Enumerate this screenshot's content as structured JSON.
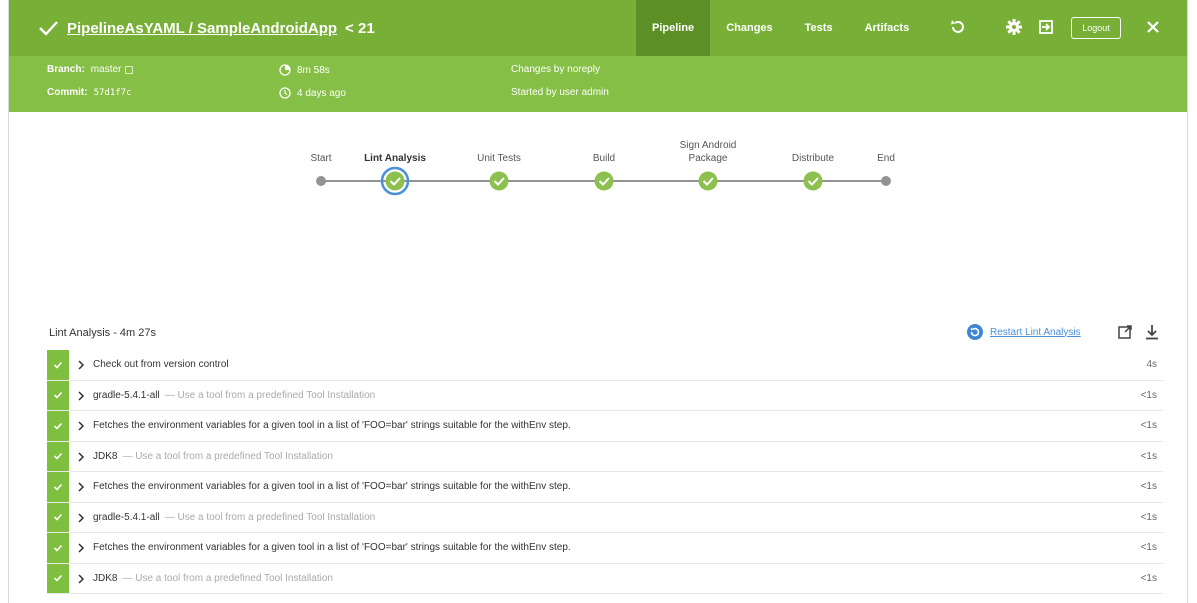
{
  "header": {
    "title": "PipelineAsYAML / SampleAndroidApp",
    "run_number": "< 21",
    "tabs": [
      {
        "label": "Pipeline",
        "active": true
      },
      {
        "label": "Changes",
        "active": false
      },
      {
        "label": "Tests",
        "active": false
      },
      {
        "label": "Artifacts",
        "active": false
      }
    ],
    "logout_label": "Logout",
    "icons": [
      "check-icon",
      "rerun-icon",
      "gear-icon",
      "exit-icon",
      "close-icon"
    ],
    "bg_color": "#78b037"
  },
  "meta": {
    "branch_label": "Branch:",
    "branch_value": "master",
    "commit_label": "Commit:",
    "commit_value": "57d1f7c",
    "duration": "8m 58s",
    "ago": "4 days ago",
    "changes": "Changes by noreply",
    "started": "Started by user admin"
  },
  "pipeline": {
    "stages": [
      {
        "label": "Start",
        "status": "none"
      },
      {
        "label": "Lint Analysis",
        "status": "success",
        "selected": true
      },
      {
        "label": "Unit Tests",
        "status": "success"
      },
      {
        "label": "Build",
        "status": "success"
      },
      {
        "label": "Sign Android Package",
        "status": "success"
      },
      {
        "label": "Distribute",
        "status": "success"
      },
      {
        "label": "End",
        "status": "none"
      }
    ]
  },
  "steps_panel": {
    "title": "Lint Analysis - 4m 27s",
    "restart_label": "Restart Lint Analysis",
    "steps": [
      {
        "name": "Check out from version control",
        "desc": "",
        "time": "4s"
      },
      {
        "name": "gradle-5.4.1-all",
        "desc": "— Use a tool from a predefined Tool Installation",
        "time": "<1s"
      },
      {
        "name": "Fetches the environment variables for a given tool in a list of 'FOO=bar' strings suitable for the withEnv step.",
        "desc": "",
        "time": "<1s"
      },
      {
        "name": "JDK8",
        "desc": "— Use a tool from a predefined Tool Installation",
        "time": "<1s"
      },
      {
        "name": "Fetches the environment variables for a given tool in a list of 'FOO=bar' strings suitable for the withEnv step.",
        "desc": "",
        "time": "<1s"
      },
      {
        "name": "gradle-5.4.1-all",
        "desc": "— Use a tool from a predefined Tool Installation",
        "time": "<1s"
      },
      {
        "name": "Fetches the environment variables for a given tool in a list of 'FOO=bar' strings suitable for the withEnv step.",
        "desc": "",
        "time": "<1s"
      },
      {
        "name": "JDK8",
        "desc": "— Use a tool from a predefined Tool Installation",
        "time": "<1s"
      }
    ]
  }
}
